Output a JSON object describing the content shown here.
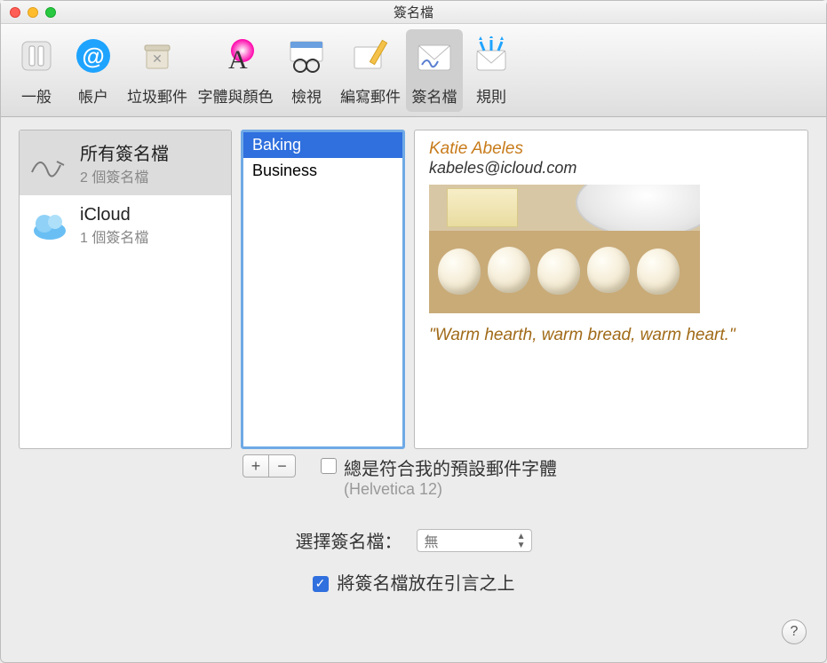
{
  "window": {
    "title": "簽名檔"
  },
  "toolbar": {
    "general": "一般",
    "accounts": "帳户",
    "junk": "垃圾郵件",
    "fonts": "字體與顏色",
    "viewing": "檢視",
    "composing": "編寫郵件",
    "signatures": "簽名檔",
    "rules": "規則"
  },
  "accounts": [
    {
      "name": "所有簽名檔",
      "sub": "2 個簽名檔"
    },
    {
      "name": "iCloud",
      "sub": "1 個簽名檔"
    }
  ],
  "signatures": {
    "items": [
      "Baking",
      "Business"
    ],
    "add_label": "+",
    "remove_label": "−"
  },
  "preview": {
    "name": "Katie Abeles",
    "email": "kabeles@icloud.com",
    "quote": "\"Warm hearth, warm bread, warm heart.\""
  },
  "match_font": {
    "label": "總是符合我的預設郵件字體",
    "sub": "(Helvetica 12)",
    "checked": false
  },
  "choose": {
    "label": "選擇簽名檔：",
    "value": "無"
  },
  "above_quoted": {
    "label": "將簽名檔放在引言之上",
    "checked": true
  },
  "help": "?"
}
